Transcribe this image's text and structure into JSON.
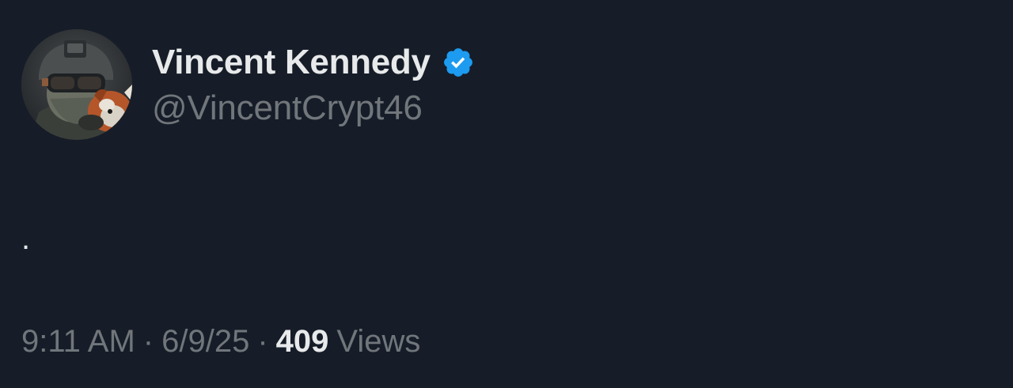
{
  "author": {
    "display_name": "Vincent Kennedy",
    "handle": "@VincentCrypt46",
    "verified_icon": "verified-badge-icon",
    "badge_color": "#1d9bf0"
  },
  "tweet": {
    "text": "."
  },
  "meta": {
    "time": "9:11 AM",
    "separator": "·",
    "date": "6/9/25",
    "views_count": "409",
    "views_label": "Views"
  },
  "colors": {
    "background": "#161d28",
    "primary_text": "#e7e9ea",
    "secondary_text": "#71767b"
  }
}
